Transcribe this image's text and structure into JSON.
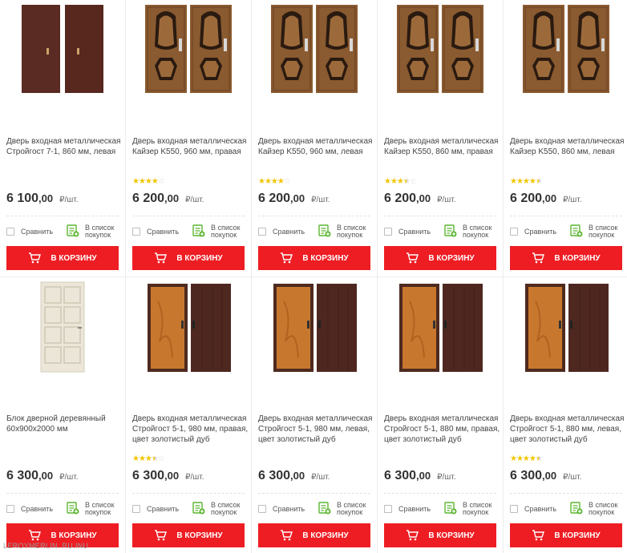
{
  "labels": {
    "compare": "Сравнить",
    "wishlist_line1": "В список",
    "wishlist_line2": "покупок",
    "cart_button": "В КОРЗИНУ",
    "currency_unit": "₽/шт."
  },
  "watermark": "LEROYMERLIN. RU.INU",
  "products": [
    {
      "title": "Дверь входная металлическая Стройгост 7-1, 860 мм, левая",
      "rating": null,
      "price_int": "6 100",
      "price_cents": ",00",
      "image": "door-pair-brown-plain-icon"
    },
    {
      "title": "Дверь входная металлическая Кайзер K550, 960 мм, правая",
      "rating": 4,
      "price_int": "6 200",
      "price_cents": ",00",
      "image": "door-pair-kaiser-icon"
    },
    {
      "title": "Дверь входная металлическая Кайзер K550, 960 мм, левая",
      "rating": 4,
      "price_int": "6 200",
      "price_cents": ",00",
      "image": "door-pair-kaiser-icon"
    },
    {
      "title": "Дверь входная металлическая Кайзер K550, 860 мм, правая",
      "rating": 3.5,
      "price_int": "6 200",
      "price_cents": ",00",
      "image": "door-pair-kaiser-icon"
    },
    {
      "title": "Дверь входная металлическая Кайзер K550, 860 мм, левая",
      "rating": 4.5,
      "price_int": "6 200",
      "price_cents": ",00",
      "image": "door-pair-kaiser-icon"
    },
    {
      "title": "Блок дверной деревянный 60x900x2000 мм",
      "rating": null,
      "price_int": "6 300",
      "price_cents": ",00",
      "image": "door-white-panel-icon"
    },
    {
      "title": "Дверь входная металлическая Стройгост 5-1, 980 мм, правая, цвет золотистый дуб",
      "rating": 3.5,
      "price_int": "6 300",
      "price_cents": ",00",
      "image": "door-pair-oak-brown-icon"
    },
    {
      "title": "Дверь входная металлическая Стройгост 5-1, 980 мм, левая, цвет золотистый дуб",
      "rating": null,
      "price_int": "6 300",
      "price_cents": ",00",
      "image": "door-pair-oak-brown-icon"
    },
    {
      "title": "Дверь входная металлическая Стройгост 5-1, 880 мм, правая, цвет золотистый дуб",
      "rating": null,
      "price_int": "6 300",
      "price_cents": ",00",
      "image": "door-pair-oak-brown-icon"
    },
    {
      "title": "Дверь входная металлическая Стройгост 5-1, 880 мм, левая, цвет золотистый дуб",
      "rating": 4.5,
      "price_int": "6 300",
      "price_cents": ",00",
      "image": "door-pair-oak-brown-icon"
    }
  ],
  "colors": {
    "accent": "#ee1d23",
    "star": "#f2c500",
    "wishlist_green": "#5cb531",
    "door_brown": "#5a2b22",
    "door_oak": "#c8782e",
    "door_kaiser": "#8a5a30"
  }
}
